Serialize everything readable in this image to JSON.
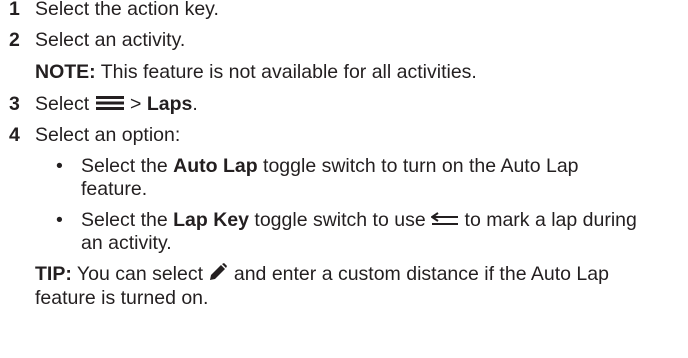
{
  "steps": [
    {
      "num": "1",
      "text": "Select the action key."
    },
    {
      "num": "2",
      "text": "Select an activity."
    },
    {
      "num": "3",
      "prefix": "Select ",
      "sep": " > ",
      "bold": "Laps",
      "suffix": ".",
      "icon": "menu-icon"
    },
    {
      "num": "4",
      "text": "Select an option:"
    }
  ],
  "note": {
    "label": "NOTE:",
    "text": " This feature is not available for all activities."
  },
  "bullets": [
    {
      "prefix": "Select the ",
      "bold": "Auto Lap",
      "suffix": " toggle switch to turn on the Auto Lap feature."
    },
    {
      "prefix": "Select the ",
      "bold": "Lap Key",
      "middle": " toggle switch to use ",
      "icon": "back-arrow-icon",
      "suffix": " to mark a lap during an activity."
    }
  ],
  "bullet_char": "•",
  "tip": {
    "label": "TIP:",
    "prefix": " You can select ",
    "icon": "pencil-icon",
    "suffix": " and enter a custom distance if the Auto Lap feature is turned on."
  },
  "colors": {
    "text": "#231f20"
  }
}
